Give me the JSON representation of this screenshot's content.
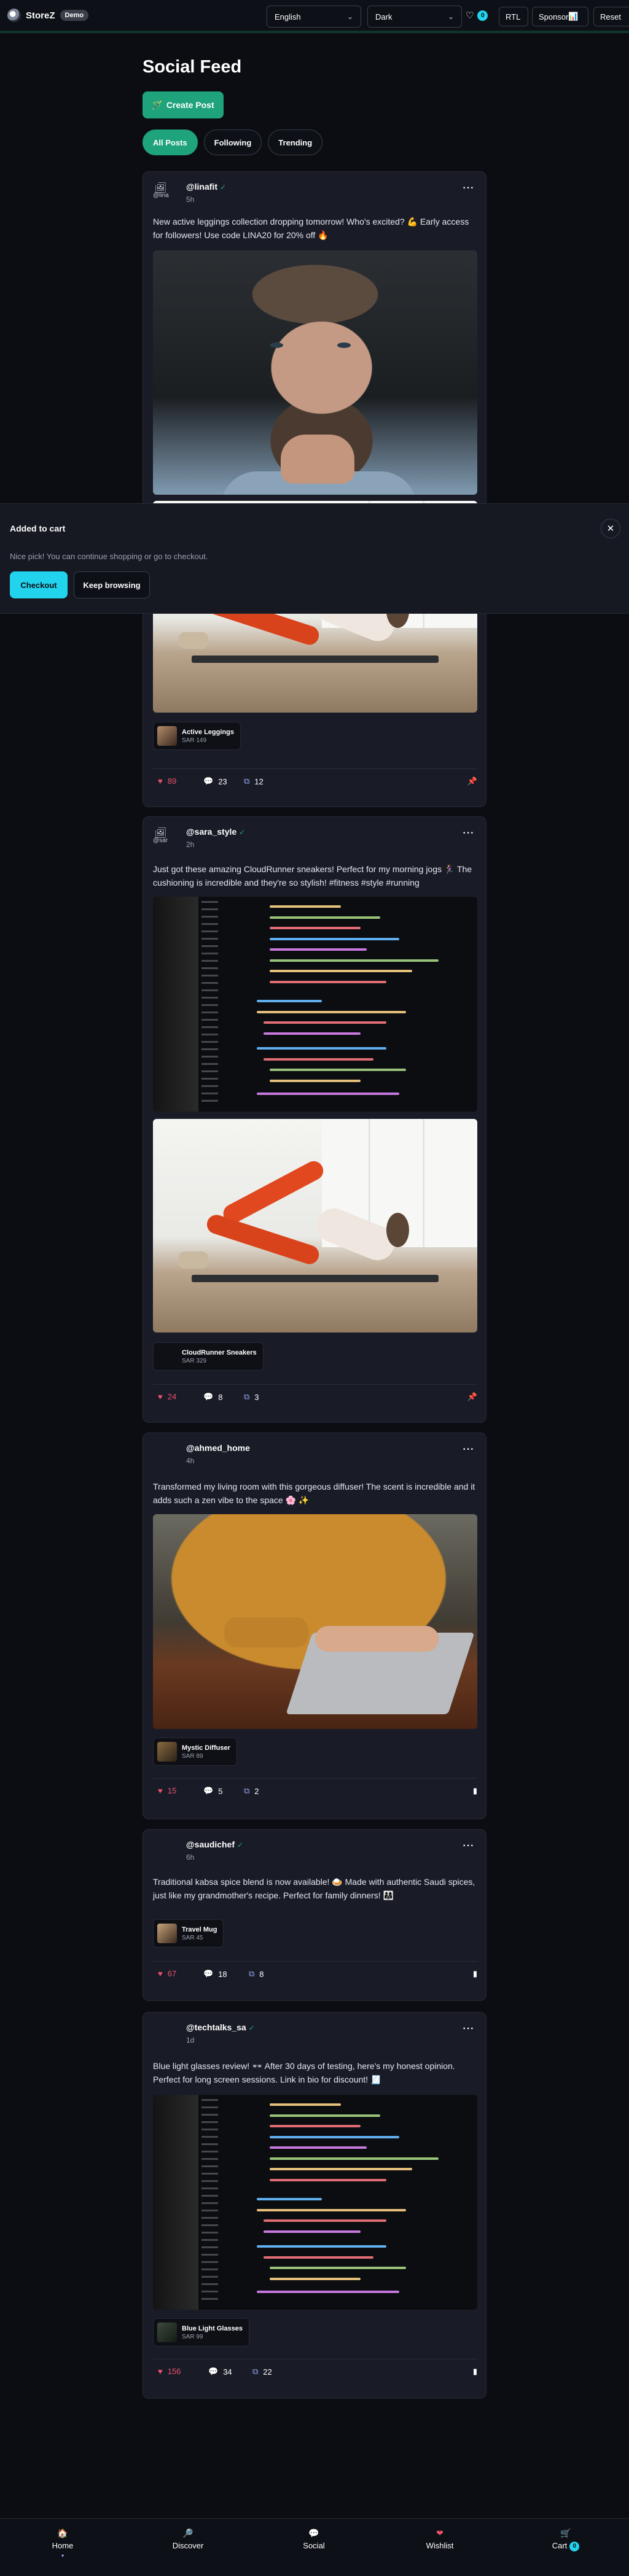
{
  "header": {
    "app_name": "StoreZ",
    "demo_badge": "Demo",
    "language": "English",
    "theme": "Dark",
    "wishlist_count": "0",
    "rtl_label": "RTL",
    "sponsor_label": "Sponsor",
    "reset_label": "Reset"
  },
  "page": {
    "title": "Social Feed",
    "create_post_label": "Create Post",
    "filters": [
      "All Posts",
      "Following",
      "Trending"
    ]
  },
  "posts": [
    {
      "username": "@linafit",
      "verified": "✓",
      "avatar_alt": "@lina",
      "time": "5h",
      "text": "New active leggings collection dropping tomorrow! Who's excited? 💪 Early access for followers! Use code LINA20 for 20% off 🔥",
      "product_name": "Active Leggings",
      "product_price": "SAR 149",
      "likes": "89",
      "comments": "23",
      "shares": "12"
    },
    {
      "username": "@sara_style",
      "verified": "✓",
      "avatar_alt": "@sar",
      "time": "2h",
      "text": "Just got these amazing CloudRunner sneakers! Perfect for my morning jogs 🏃‍♀️ The cushioning is incredible and they're so stylish! #fitness #style #running",
      "product_name": "CloudRunner Sneakers",
      "product_price": "SAR 329",
      "likes": "24",
      "comments": "8",
      "shares": "3"
    },
    {
      "username": "@ahmed_home",
      "verified": "",
      "time": "4h",
      "text": "Transformed my living room with this gorgeous diffuser! The scent is incredible and it adds such a zen vibe to the space 🌸 ✨",
      "product_name": "Mystic Diffuser",
      "product_price": "SAR 89",
      "likes": "15",
      "comments": "5",
      "shares": "2"
    },
    {
      "username": "@saudichef",
      "verified": "✓",
      "time": "6h",
      "text": "Traditional kabsa spice blend is now available! 🍛 Made with authentic Saudi spices, just like my grandmother's recipe. Perfect for family dinners! 👨‍👩‍👧",
      "product_name": "Travel Mug",
      "product_price": "SAR 45",
      "likes": "67",
      "comments": "18",
      "shares": "8"
    },
    {
      "username": "@techtalks_sa",
      "verified": "✓",
      "time": "1d",
      "text": "Blue light glasses review! 👓 After 30 days of testing, here's my honest opinion. Perfect for long screen sessions. Link in bio for discount! 🧾",
      "product_name": "Blue Light Glasses",
      "product_price": "SAR 99",
      "likes": "156",
      "comments": "34",
      "shares": "22"
    }
  ],
  "toast": {
    "title": "Added to cart",
    "message": "Nice pick! You can continue shopping or go to checkout.",
    "checkout_label": "Checkout",
    "keep_label": "Keep browsing",
    "close_glyph": "✕"
  },
  "bottom_nav": {
    "items": [
      {
        "label": "Home",
        "icon": "🏠"
      },
      {
        "label": "Discover",
        "icon": "🔎"
      },
      {
        "label": "Social",
        "icon": "💬"
      },
      {
        "label": "Wishlist",
        "icon": "❤"
      },
      {
        "label": "Cart",
        "icon": "🛒"
      }
    ],
    "cart_count": "0"
  },
  "colors": {
    "accent_green": "#1fa37c",
    "accent_cyan": "#22d3ee",
    "like_pink": "#ef4f6d",
    "background": "#0b0d12",
    "card": "#191c27"
  }
}
